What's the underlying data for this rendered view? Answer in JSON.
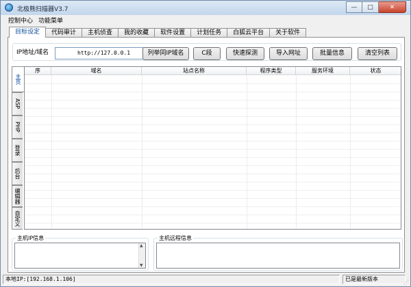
{
  "window": {
    "title": "北极熊扫描器V3.7",
    "min": "—",
    "max": "□",
    "close": "✕"
  },
  "menu": [
    "控制中心",
    "功能菜单"
  ],
  "tabs": [
    "目标设定",
    "代码审计",
    "主机侦查",
    "我的收藏",
    "软件设置",
    "计划任务",
    "白狐云平台",
    "关于软件"
  ],
  "target": {
    "label": "IP地址/域名",
    "value": "http://127.0.0.1",
    "buttons": [
      "列举同IP域名",
      "C段",
      "快速探测",
      "导入网址",
      "批量信息",
      "清空列表"
    ]
  },
  "side_tabs": [
    "主页",
    "ASP",
    "PHP",
    "登录",
    "后台",
    "编辑器",
    "自定义"
  ],
  "grid": {
    "columns": [
      "序",
      "域名",
      "站点名称",
      "程序类型",
      "服务环境",
      "状态"
    ]
  },
  "host_ip_info": {
    "title": "主机IP信息"
  },
  "host_process_info": {
    "title": "主机远程信息"
  },
  "status": {
    "local_ip": "本地IP:[192.168.1.106]",
    "version": "已是最新版本"
  }
}
